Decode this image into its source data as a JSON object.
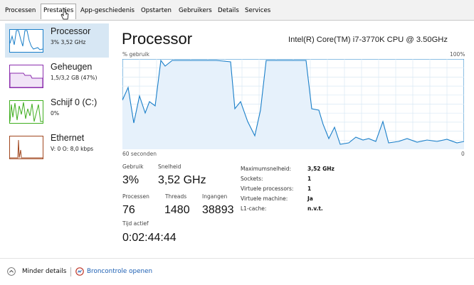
{
  "tabs": [
    "Processen",
    "Prestaties",
    "App-geschiedenis",
    "Opstarten",
    "Gebruikers",
    "Details",
    "Services"
  ],
  "active_tab": "Prestaties",
  "sidebar": {
    "items": [
      {
        "title": "Processor",
        "subtitle": "3% 3,52 GHz",
        "color": "#1a7fc9",
        "selected": true
      },
      {
        "title": "Geheugen",
        "subtitle": "1,5/3,2 GB (47%)",
        "color": "#8b2dad",
        "selected": false
      },
      {
        "title": "Schijf 0 (C:)",
        "subtitle": "0%",
        "color": "#3fae1e",
        "selected": false
      },
      {
        "title": "Ethernet",
        "subtitle": "V: 0 O: 8,0 kbps",
        "color": "#a1471f",
        "selected": false
      }
    ]
  },
  "main": {
    "title": "Processor",
    "cpu_model": "Intel(R) Core(TM) i7-3770K CPU @ 3.50GHz",
    "graph": {
      "y_label": "% gebruik",
      "y_max_label": "100%",
      "x_left_label": "60 seconden",
      "x_right_label": "0",
      "accent": "#1a7fc9",
      "fill": "#e6f1fb"
    },
    "stats": {
      "usage_label": "Gebruik",
      "usage_value": "3%",
      "speed_label": "Snelheid",
      "speed_value": "3,52 GHz",
      "processes_label": "Processen",
      "processes_value": "76",
      "threads_label": "Threads",
      "threads_value": "1480",
      "handles_label": "Ingangen",
      "handles_value": "38893",
      "uptime_label": "Tijd actief",
      "uptime_value": "0:02:44:44"
    },
    "specs": [
      {
        "label": "Maximumsnelheid:",
        "value": "3,52 GHz"
      },
      {
        "label": "Sockets:",
        "value": "1"
      },
      {
        "label": "Virtuele processors:",
        "value": "1"
      },
      {
        "label": "Virtuele machine:",
        "value": "Ja"
      },
      {
        "label": "L1-cache:",
        "value": "n.v.t."
      }
    ]
  },
  "footer": {
    "fewer_details": "Minder details",
    "open_monitor": "Broncontrole openen"
  }
}
